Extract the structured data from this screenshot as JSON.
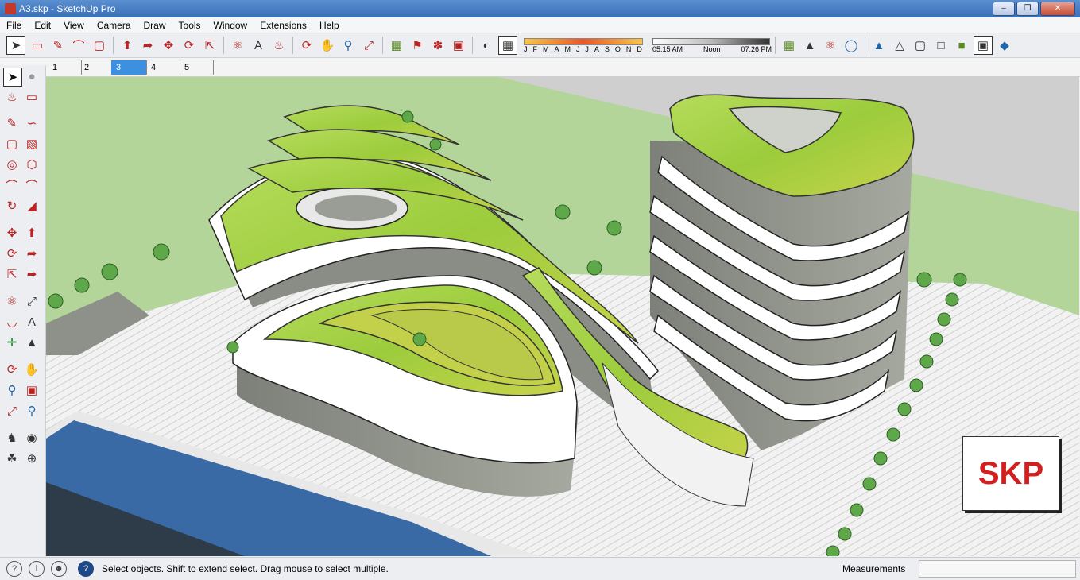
{
  "window": {
    "title": "A3.skp - SketchUp Pro"
  },
  "menu": [
    "File",
    "Edit",
    "View",
    "Camera",
    "Draw",
    "Tools",
    "Window",
    "Extensions",
    "Help"
  ],
  "toolbar": {
    "icons": [
      "select-icon",
      "eraser-icon",
      "pencil-icon",
      "arc-icon",
      "rectangle-icon",
      "push-pull-icon",
      "follow-me-icon",
      "move-icon",
      "rotate-icon",
      "scale-icon",
      "tape-measure-icon",
      "text-icon",
      "paint-bucket-icon",
      "orbit-icon",
      "pan-icon",
      "zoom-icon",
      "zoom-extents-icon",
      "components-icon",
      "add-location-icon",
      "geolocation-icon",
      "photo-texture-icon",
      "shadows-icon",
      "fog-icon"
    ],
    "shadow_months": [
      "J",
      "F",
      "M",
      "A",
      "M",
      "J",
      "J",
      "A",
      "S",
      "O",
      "N",
      "D"
    ],
    "shadow_times": [
      "05:15 AM",
      "Noon",
      "07:26 PM"
    ]
  },
  "scenes": [
    "1",
    "2",
    "3",
    "4",
    "5"
  ],
  "active_scene": "3",
  "viewport": {
    "watermark": "SKP"
  },
  "status": {
    "message": "Select objects. Shift to extend select. Drag mouse to select multiple.",
    "measurements_label": "Measurements"
  },
  "colors": {
    "accent": "#3d8fe0",
    "watermark": "#d21f1f",
    "ground": "#a8cf88",
    "water": "#3a6aa6",
    "roof_green": "#8dc63f"
  }
}
